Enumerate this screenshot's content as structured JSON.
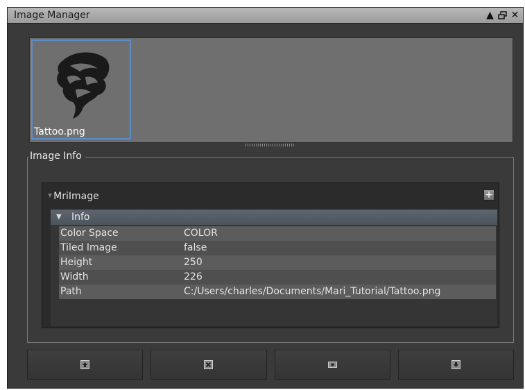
{
  "window": {
    "title": "Image Manager",
    "icons": [
      "float-icon",
      "restore-icon",
      "close-icon"
    ]
  },
  "thumbnails": [
    {
      "label": "Tattoo.png",
      "selected": true,
      "icon": "lion-tattoo-image"
    }
  ],
  "image_info": {
    "group_title": "Image Info",
    "node": {
      "label": "MriImage",
      "expanded": true,
      "add_label": "+"
    },
    "section": {
      "label": "Info",
      "expanded": true
    },
    "properties": [
      {
        "name": "Color Space",
        "value": "COLOR"
      },
      {
        "name": "Tiled Image",
        "value": "false"
      },
      {
        "name": "Height",
        "value": "250"
      },
      {
        "name": "Width",
        "value": "226"
      },
      {
        "name": "Path",
        "value": "C:/Users/charles/Documents/Mari_Tutorial/Tattoo.png"
      }
    ]
  },
  "toolbar": {
    "buttons": [
      {
        "icon": "import-image-icon"
      },
      {
        "icon": "remove-image-icon"
      },
      {
        "icon": "view-image-icon"
      },
      {
        "icon": "export-image-icon"
      }
    ]
  },
  "colors": {
    "accent": "#5a8ec8",
    "panel": "#3a3a3a",
    "thumb_bg": "#6f6f6f"
  }
}
